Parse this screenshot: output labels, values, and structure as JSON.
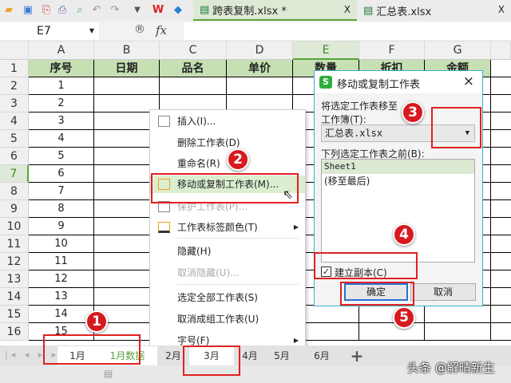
{
  "toolbar": {
    "icons": [
      "open-folder-icon",
      "save-icon",
      "export-pdf-icon",
      "print-icon",
      "print-preview-icon",
      "undo-icon",
      "redo-icon",
      "more-dropdown-icon",
      "wps-logo-icon",
      "cube-app-icon"
    ]
  },
  "file_tabs": [
    {
      "label": "跨表复制.xlsx *",
      "active": true,
      "close": "X"
    },
    {
      "label": "汇总表.xlsx",
      "active": false,
      "close": "X"
    }
  ],
  "formula_bar": {
    "cell_ref": "E7",
    "fx": "fx",
    "value": ""
  },
  "columns": [
    "A",
    "B",
    "C",
    "D",
    "E",
    "F",
    "G"
  ],
  "header_row": [
    "序号",
    "日期",
    "品名",
    "单价",
    "数量",
    "折扣",
    "金额"
  ],
  "rows": [
    "1",
    "2",
    "3",
    "4",
    "5",
    "6",
    "7",
    "8",
    "9",
    "10",
    "11",
    "12",
    "13",
    "14",
    "15"
  ],
  "row_numbers": [
    "1",
    "2",
    "3",
    "4",
    "5",
    "6",
    "7",
    "8",
    "9",
    "10",
    "11",
    "12",
    "13",
    "14",
    "15",
    "16"
  ],
  "context_menu": {
    "items": [
      {
        "label": "插入(I)...",
        "icon": "table-insert-icon"
      },
      {
        "label": "删除工作表(D)"
      },
      {
        "label": "重命名(R)"
      },
      {
        "label": "移动或复制工作表(M)...",
        "icon": "move-copy-sheet-icon",
        "highlighted": true
      },
      {
        "label": "保护工作表(P)...",
        "icon": "lock-icon",
        "disabled": true
      },
      {
        "label": "工作表标签颜色(T)",
        "icon": "tab-color-icon",
        "submenu": true
      },
      {
        "label": "隐藏(H)"
      },
      {
        "label": "取消隐藏(U)...",
        "disabled": true
      },
      {
        "label": "选定全部工作表(S)"
      },
      {
        "label": "取消成组工作表(U)"
      },
      {
        "label": "字号(F)",
        "submenu": true
      }
    ]
  },
  "dialog": {
    "title": "移动或复制工作表",
    "close": "×",
    "move_to_label": "将选定工作表移至",
    "workbook_label": "工作簿(T):",
    "workbook_value": "汇总表.xlsx",
    "before_label": "下列选定工作表之前(B):",
    "list": [
      "Sheet1",
      "(移至最后)"
    ],
    "copy_label": "建立副本(C)",
    "copy_checked": true,
    "ok": "确定",
    "cancel": "取消"
  },
  "sheet_tabs": [
    "1月",
    "1月数据",
    "2月",
    "3月",
    "4月",
    "5月",
    "6月"
  ],
  "add_sheet": "+",
  "badges": [
    "1",
    "2",
    "3",
    "4",
    "5"
  ],
  "watermark": "头条 @解晴新生",
  "colors": {
    "accent": "#5aa33c",
    "header_fill": "#c6e0b4",
    "annotation_red": "#e02020"
  }
}
